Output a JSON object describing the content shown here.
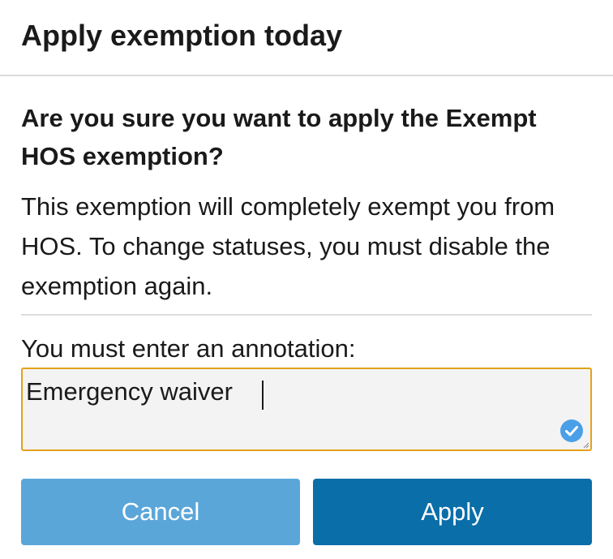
{
  "dialog": {
    "title": "Apply exemption today",
    "question": "Are you sure you want to apply the Exempt HOS exemption?",
    "description": "This exemption will completely exempt you from HOS. To change statuses, you must disable the exemption again.",
    "annotation": {
      "label": "You must enter an annotation:",
      "value": "Emergency waiver",
      "valid_icon": "check-circle-icon",
      "border_color": "#e3a21a",
      "valid_color": "#4a9fe8"
    },
    "buttons": {
      "cancel_label": "Cancel",
      "apply_label": "Apply",
      "cancel_color": "#5ba6d9",
      "apply_color": "#0a6ea8"
    }
  }
}
